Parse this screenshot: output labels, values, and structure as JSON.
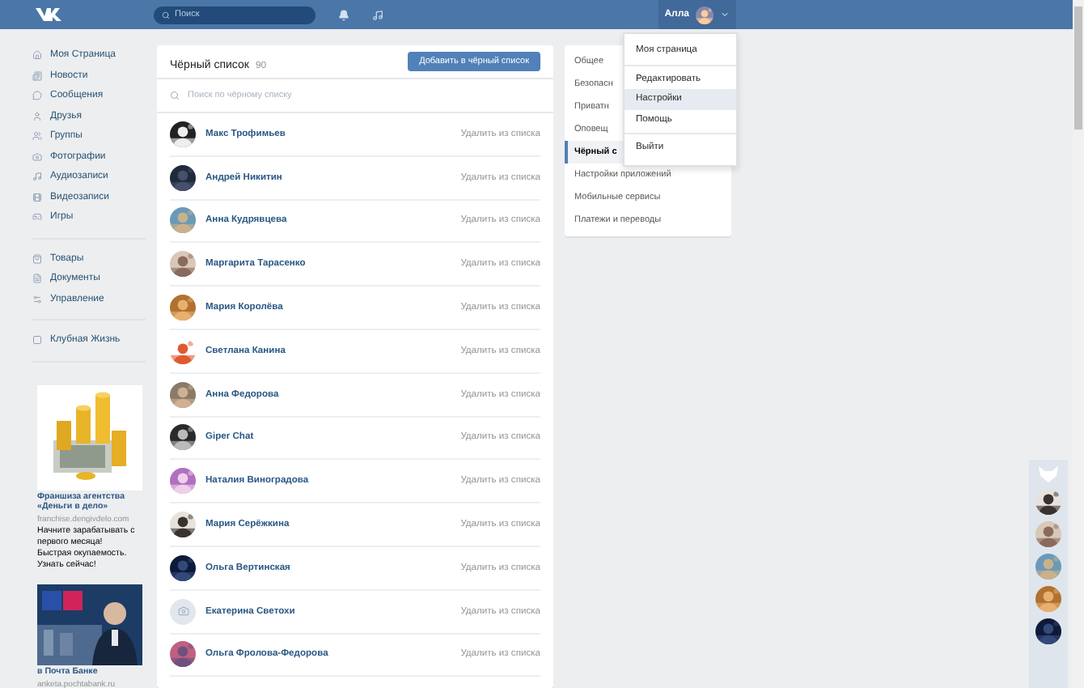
{
  "top_bar": {
    "search": {
      "placeholder": "Поиск"
    },
    "user": {
      "name": "Алла"
    }
  },
  "left_nav": {
    "groups": [
      [
        {
          "label": "Моя Страница"
        },
        {
          "label": "Новости"
        },
        {
          "label": "Сообщения"
        },
        {
          "label": "Друзья"
        },
        {
          "label": "Группы"
        },
        {
          "label": "Фотографии"
        },
        {
          "label": "Аудиозаписи"
        },
        {
          "label": "Видеозаписи"
        },
        {
          "label": "Игры"
        }
      ],
      [
        {
          "label": "Товары"
        },
        {
          "label": "Документы"
        },
        {
          "label": "Управление"
        }
      ],
      [
        {
          "label": "Клубная Жизнь"
        }
      ]
    ]
  },
  "ads": [
    {
      "kind": "coins",
      "title": "Франшиза агентства «Деньги в дело»",
      "site": "franchise.dengivdelo.com",
      "text": "Начните зарабатывать с первого месяца! Быстрая окупаемость. Узнать сейчас!"
    },
    {
      "kind": "bank",
      "title": "в Почта Банке",
      "site": "anketa.pochtabank.ru"
    }
  ],
  "blacklist": {
    "title": "Чёрный список",
    "count": "90",
    "add_button": "Добавить в чёрный список",
    "search_placeholder": "Поиск по чёрному списку",
    "rows": [
      {
        "name": "Макс Трофимьев",
        "action": "Удалить из списка",
        "kind": "picture"
      },
      {
        "name": "Андрей Никитин",
        "action": "Удалить из списка",
        "kind": "picture"
      },
      {
        "name": "Анна Кудрявцева",
        "action": "Удалить из списка",
        "kind": "picture"
      },
      {
        "name": "Маргарита Тарасенко",
        "action": "Удалить из списка",
        "kind": "picture"
      },
      {
        "name": "Мария Королёва",
        "action": "Удалить из списка",
        "kind": "picture"
      },
      {
        "name": "Светлана Канина",
        "action": "Удалить из списка",
        "kind": "picture"
      },
      {
        "name": "Анна Федорова",
        "action": "Удалить из списка",
        "kind": "picture"
      },
      {
        "name": "Giper Chat",
        "action": "Удалить из списка",
        "kind": "picture"
      },
      {
        "name": "Наталия Виноградова",
        "action": "Удалить из списка",
        "kind": "picture"
      },
      {
        "name": "Мария Серёжкина",
        "action": "Удалить из списка",
        "kind": "picture"
      },
      {
        "name": "Ольга Вертинская",
        "action": "Удалить из списка",
        "kind": "picture"
      },
      {
        "name": "Екатерина Светохи",
        "action": "Удалить из списка",
        "kind": "camera"
      },
      {
        "name": "Ольга Фролова-Федорова",
        "action": "Удалить из списка",
        "kind": "picture"
      }
    ]
  },
  "settings_nav": {
    "items": [
      {
        "label": "Общее",
        "selected": false
      },
      {
        "label": "Безопасн",
        "selected": false
      },
      {
        "label": "Приватн",
        "selected": false
      },
      {
        "label": "Оповещ",
        "selected": false
      },
      {
        "label": "Чёрный с",
        "selected": true
      },
      {
        "label": "Настройки приложений",
        "selected": false
      },
      {
        "label": "Мобильные сервисы",
        "selected": false
      },
      {
        "label": "Платежи и переводы",
        "selected": false
      }
    ]
  },
  "user_menu": {
    "groups": [
      [
        {
          "label": "Моя страница",
          "selected": false
        }
      ],
      [
        {
          "label": "Редактировать",
          "selected": false
        },
        {
          "label": "Настройки",
          "selected": true
        },
        {
          "label": "Помощь",
          "selected": false
        }
      ],
      [
        {
          "label": "Выйти",
          "selected": false
        }
      ]
    ]
  }
}
